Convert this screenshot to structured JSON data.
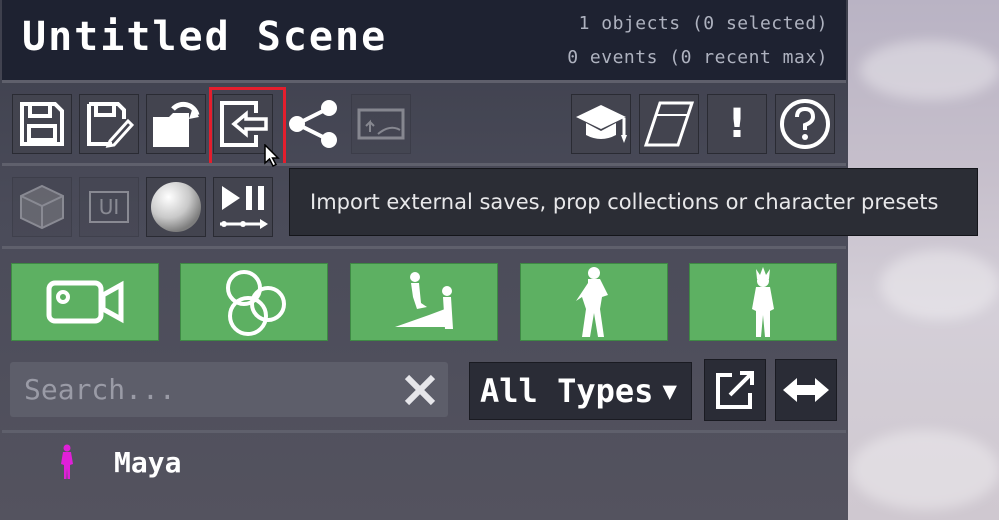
{
  "header": {
    "title": "Untitled Scene",
    "objects_stat": "1 objects (0 selected)",
    "events_stat": "0 events (0 recent max)"
  },
  "toolbar_top": [
    {
      "name": "save-icon",
      "active": true
    },
    {
      "name": "save-as-icon",
      "active": true
    },
    {
      "name": "open-folder-icon",
      "active": true
    },
    {
      "name": "import-icon",
      "active": true,
      "highlighted": true
    },
    {
      "name": "share-icon",
      "active": true
    },
    {
      "name": "image-icon",
      "active": false
    },
    {
      "name": "graduation-cap-icon",
      "active": true
    },
    {
      "name": "cube-frame-icon",
      "active": true
    },
    {
      "name": "exclamation-icon",
      "active": true
    },
    {
      "name": "help-icon",
      "active": true
    }
  ],
  "toolbar_second": [
    {
      "name": "cube-icon",
      "active": false
    },
    {
      "name": "ui-icon",
      "label": "UI",
      "active": false
    },
    {
      "name": "sphere-icon",
      "active": true
    },
    {
      "name": "play-pause-icon",
      "active": true
    }
  ],
  "tooltip": {
    "text": "Import external saves, prop collections or character presets"
  },
  "add_buttons": [
    {
      "name": "camera-icon"
    },
    {
      "name": "circles-icon"
    },
    {
      "name": "couple-pose-icon"
    },
    {
      "name": "female-silhouette-icon"
    },
    {
      "name": "creature-silhouette-icon"
    }
  ],
  "search": {
    "placeholder": "Search...",
    "value": ""
  },
  "type_filter": {
    "selected": "All Types",
    "caret": "▼"
  },
  "list": [
    {
      "label": "Maya",
      "color": "#e020d8"
    }
  ],
  "colors": {
    "accent_green": "#5db062",
    "highlight_red": "#e41e2d",
    "header_bg": "#1e2231"
  }
}
